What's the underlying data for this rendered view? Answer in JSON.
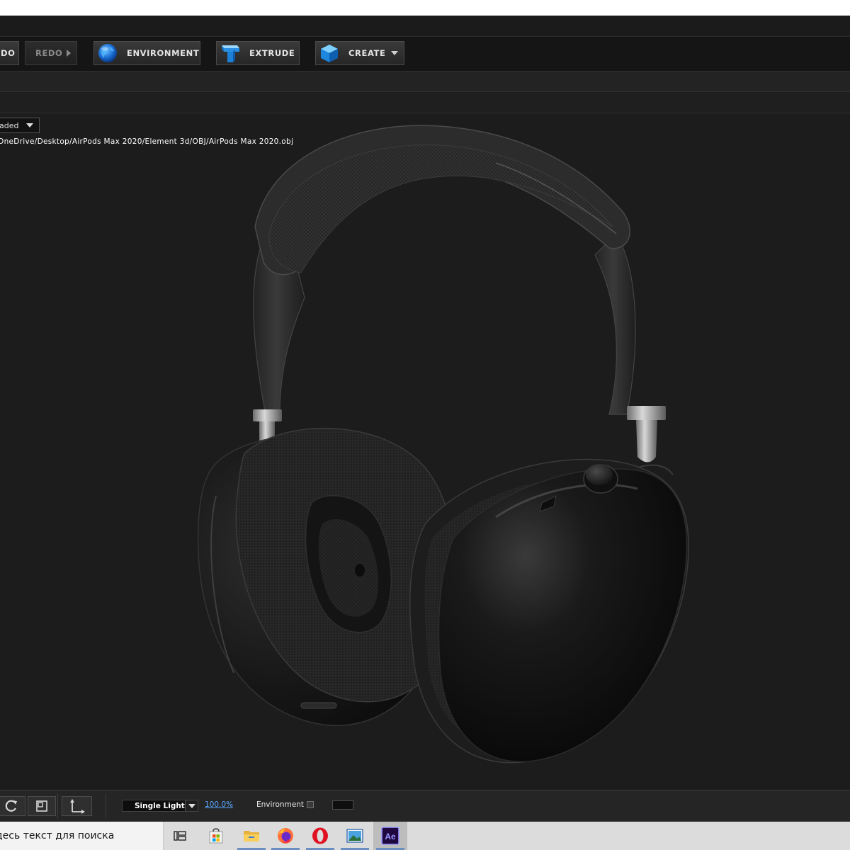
{
  "toolbar": {
    "undo_label": "DO",
    "redo_label": "REDO",
    "environment_label": "ENVIRONMENT",
    "extrude_label": "EXTRUDE",
    "create_label": "CREATE"
  },
  "viewport": {
    "render_mode": "aded",
    "file_path": "OneDrive/Desktop/AirPods Max 2020/Element 3d/OBJ/AirPods Max 2020.obj"
  },
  "bottom_bar": {
    "light_mode": "Single Light",
    "zoom": "100.0%",
    "environment_label": "Environment"
  },
  "taskbar": {
    "search_placeholder": "десь текст для поиска",
    "ae_label": "Ae",
    "icons": [
      "task-view-icon",
      "store-icon",
      "file-explorer-icon",
      "firefox-icon",
      "opera-icon",
      "photos-icon",
      "after-effects-icon"
    ]
  },
  "colors": {
    "app_background": "#1c1c1c",
    "toolbar_background": "#151515",
    "zoom_link": "#5aa8ff",
    "after_effects_purple": "#9999ff",
    "after_effects_dark": "#1f0740",
    "opera_red": "#e01222",
    "firefox_orange": "#ff7139"
  }
}
